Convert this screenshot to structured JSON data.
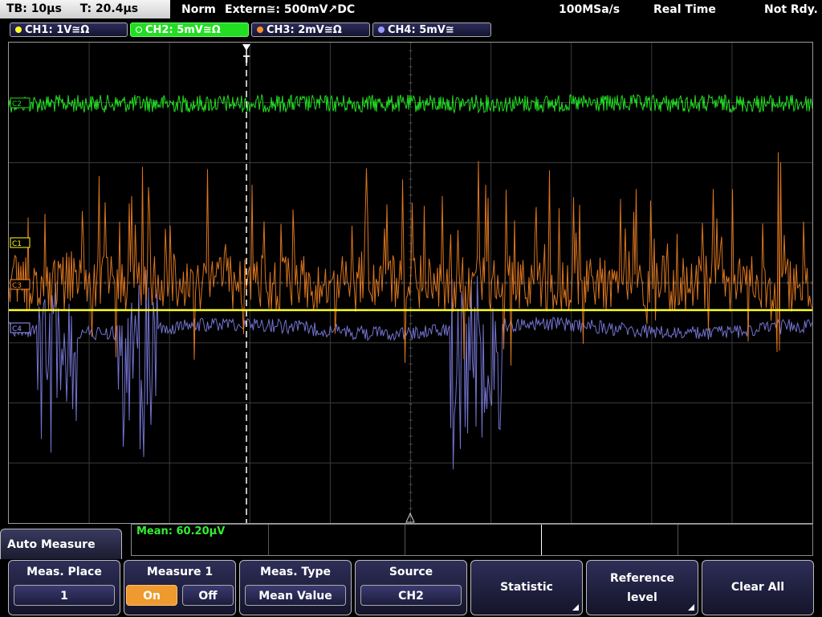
{
  "status": {
    "tb": "TB: 10µs",
    "t": "T: 20.4µs",
    "mode": "Norm",
    "trigger": "Extern≅: 500mV↗DC",
    "rate": "100MSa/s",
    "acq": "Real Time",
    "state": "Not Rdy."
  },
  "channels": [
    {
      "label": "CH1: 1V≅Ω",
      "color": "#ffff22"
    },
    {
      "label": "CH2: 5mV≅Ω",
      "color": "#22dd22"
    },
    {
      "label": "CH3: 2mV≅Ω",
      "color": "#ff8c2a"
    },
    {
      "label": "CH4: 5mV≅",
      "color": "#9a9aff"
    }
  ],
  "markers": {
    "c2": "C2",
    "c1": "C1",
    "c3": "C3",
    "c4": "C4",
    "trigger": "T"
  },
  "measurement": {
    "mean": "Mean: 60.20µV"
  },
  "menu": {
    "title": "Auto Measure",
    "place_label": "Meas. Place",
    "place_value": "1",
    "measure_label": "Measure 1",
    "on": "On",
    "off": "Off",
    "type_label": "Meas. Type",
    "type_value": "Mean Value",
    "source_label": "Source",
    "source_value": "CH2",
    "statistic": "Statistic",
    "reference_1": "Reference",
    "reference_2": "level",
    "clear_all": "Clear All"
  },
  "colors": {
    "ch1": "#ffff22",
    "ch2": "#22dd22",
    "ch3": "#ff8c2a",
    "ch4": "#8a8aee",
    "accent": "#ef9a2e"
  },
  "icons": [
    "trigger-marker-icon",
    "softkey-submenu-icon"
  ]
}
